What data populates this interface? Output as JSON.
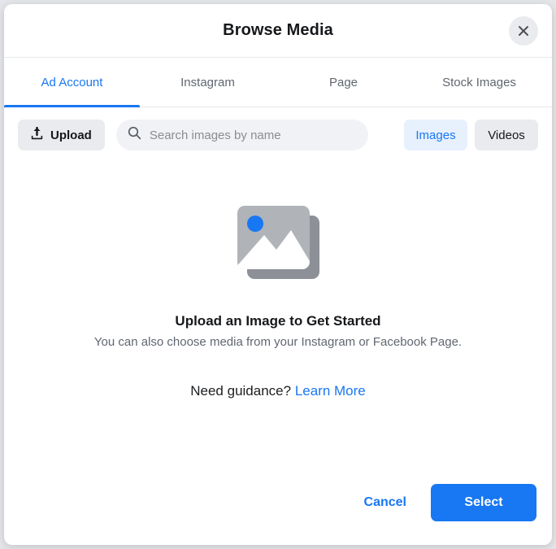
{
  "dialog": {
    "title": "Browse Media",
    "close_icon": "close-icon"
  },
  "tabs": [
    {
      "label": "Ad Account",
      "active": true
    },
    {
      "label": "Instagram",
      "active": false
    },
    {
      "label": "Page",
      "active": false
    },
    {
      "label": "Stock Images",
      "active": false
    }
  ],
  "toolbar": {
    "upload_label": "Upload",
    "upload_icon": "upload-icon",
    "search_icon": "search-icon",
    "search_placeholder": "Search images by name",
    "search_value": "",
    "media_type_options": [
      {
        "label": "Images",
        "selected": true
      },
      {
        "label": "Videos",
        "selected": false
      }
    ]
  },
  "empty_state": {
    "illustration": "image-placeholder-icon",
    "title": "Upload an Image to Get Started",
    "subtitle": "You can also choose media from your Instagram or Facebook Page.",
    "guidance_text": "Need guidance?",
    "guidance_link": "Learn More"
  },
  "footer": {
    "cancel_label": "Cancel",
    "select_label": "Select"
  },
  "colors": {
    "accent_blue": "#1877f2",
    "selected_chip_bg": "#e7f0fd",
    "neutral_bg": "#e9ebee",
    "search_bg": "#f0f2f5",
    "text_primary": "#16181b",
    "text_secondary": "#606770",
    "illustration_front": "#b0b3b8",
    "illustration_back": "#8d9096",
    "illustration_sun": "#1877f2"
  }
}
